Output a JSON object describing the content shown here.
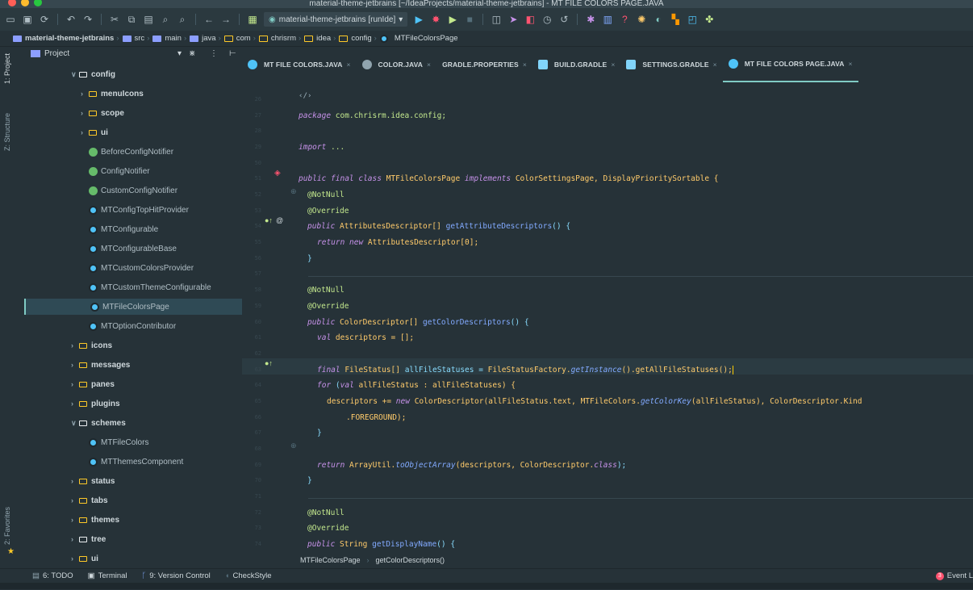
{
  "window": {
    "title": "material-theme-jetbrains [~/IdeaProjects/material-theme-jetbrains] - MT FILE COLORS PAGE.JAVA"
  },
  "toolbar": {
    "run_config": "material-theme-jetbrains [runIde]"
  },
  "navbar": {
    "crumbs": [
      "material-theme-jetbrains",
      "src",
      "main",
      "java",
      "com",
      "chrisrm",
      "idea",
      "config",
      "MTFileColorsPage"
    ]
  },
  "left_tools": {
    "project": "1: Project",
    "structure": "Z: Structure",
    "favorites": "2: Favorites"
  },
  "project": {
    "header": "Project",
    "tree": [
      {
        "label": "config",
        "kind": "folder-open"
      },
      {
        "label": "menuIcons",
        "kind": "folder"
      },
      {
        "label": "scope",
        "kind": "folder"
      },
      {
        "label": "ui",
        "kind": "folder"
      },
      {
        "label": "BeforeConfigNotifier",
        "kind": "interface"
      },
      {
        "label": "ConfigNotifier",
        "kind": "interface"
      },
      {
        "label": "CustomConfigNotifier",
        "kind": "interface"
      },
      {
        "label": "MTConfigTopHitProvider",
        "kind": "class"
      },
      {
        "label": "MTConfigurable",
        "kind": "class"
      },
      {
        "label": "MTConfigurableBase",
        "kind": "class"
      },
      {
        "label": "MTCustomColorsProvider",
        "kind": "class"
      },
      {
        "label": "MTCustomThemeConfigurable",
        "kind": "class"
      },
      {
        "label": "MTFileColorsPage",
        "kind": "class"
      },
      {
        "label": "MTOptionContributor",
        "kind": "class"
      },
      {
        "label": "icons",
        "kind": "folder"
      },
      {
        "label": "messages",
        "kind": "folder"
      },
      {
        "label": "panes",
        "kind": "folder"
      },
      {
        "label": "plugins",
        "kind": "folder"
      },
      {
        "label": "schemes",
        "kind": "folder-open"
      },
      {
        "label": "MTFileColors",
        "kind": "class"
      },
      {
        "label": "MTThemesComponent",
        "kind": "class"
      },
      {
        "label": "status",
        "kind": "folder"
      },
      {
        "label": "tabs",
        "kind": "folder"
      },
      {
        "label": "themes",
        "kind": "folder"
      },
      {
        "label": "tree",
        "kind": "folder"
      },
      {
        "label": "ui",
        "kind": "folder"
      }
    ]
  },
  "tabs": [
    {
      "label": "MT FILE COLORS.JAVA"
    },
    {
      "label": "COLOR.JAVA"
    },
    {
      "label": "GRADLE.PROPERTIES"
    },
    {
      "label": "BUILD.GRADLE"
    },
    {
      "label": "SETTINGS.GRADLE"
    },
    {
      "label": "MT FILE COLORS PAGE.JAVA"
    }
  ],
  "code": {
    "line_numbers": [
      "26",
      "27",
      "28",
      "29",
      "50",
      "51",
      "52",
      "53",
      "54",
      "55",
      "56",
      "57",
      "58",
      "59",
      "60",
      "61",
      "62",
      "63",
      "64",
      "65",
      "66",
      "67",
      "68",
      "69",
      "70",
      "71",
      "72",
      "73",
      "74"
    ],
    "l_package_kw": "package",
    "l_package": " com.chrisrm.idea.config;",
    "l_import_kw": "import",
    "l_import": " ...",
    "l_class_kw": "public final class",
    "l_class_name": " MTFileColorsPage",
    "l_impl_kw": " implements",
    "l_class_rest": " ColorSettingsPage, DisplayPrioritySortable {",
    "notnull": "@NotNull",
    "override": "@Override",
    "public": "public",
    "m1_type": " AttributesDescriptor[]",
    "m1_name": " getAttributeDescriptors",
    "m1_rest": "() {",
    "ret_kw": "return new",
    "ret1": " AttributesDescriptor[0];",
    "brace": "}",
    "m2_type": " ColorDescriptor[]",
    "m2_name": " getColorDescriptors",
    "m2_rest": "() {",
    "val_kw": "val",
    "val_rest": " descriptors = [];",
    "final_kw": "final",
    "final_type": " FileStatus[]",
    "final_rest": " allFileStatuses = ",
    "final_factory": "FileStatusFactory.",
    "final_getinst": "getInstance",
    "final_end": "().getAllFileStatuses();",
    "for_kw": "for",
    "for_open": " (",
    "for_val": "val",
    "for_rest": " allFileStatus : allFileStatuses) {",
    "desc_a": "descriptors += ",
    "desc_new": "new",
    "desc_b": " ColorDescriptor(allFileStatus.text, MTFileColors.",
    "desc_getck": "getColorKey",
    "desc_c": "(allFileStatus), ColorDescriptor.Kind",
    "desc_fg": ".FOREGROUND);",
    "inner_brace": "}",
    "return_kw": "return",
    "return_a": " ArrayUtil.",
    "return_toarr": "toObjectArray",
    "return_b": "(descriptors, ColorDescriptor.",
    "return_class": "class",
    "return_c": ");",
    "m3_type": " String",
    "m3_name": " getDisplayName",
    "m3_rest": "() {"
  },
  "editor_breadcrumb": {
    "a": "MTFileColorsPage",
    "b": "getColorDescriptors()"
  },
  "bottom_tools": {
    "todo": "6: TODO",
    "terminal": "Terminal",
    "vcs": "9: Version Control",
    "checkstyle": "CheckStyle",
    "event": "Event L"
  },
  "colors": {
    "accent": "#80CBC4",
    "bg": "#263238",
    "keyword": "#C792EA",
    "type": "#FFCB6B",
    "annotation": "#C3E88D",
    "function": "#82AAFF"
  }
}
